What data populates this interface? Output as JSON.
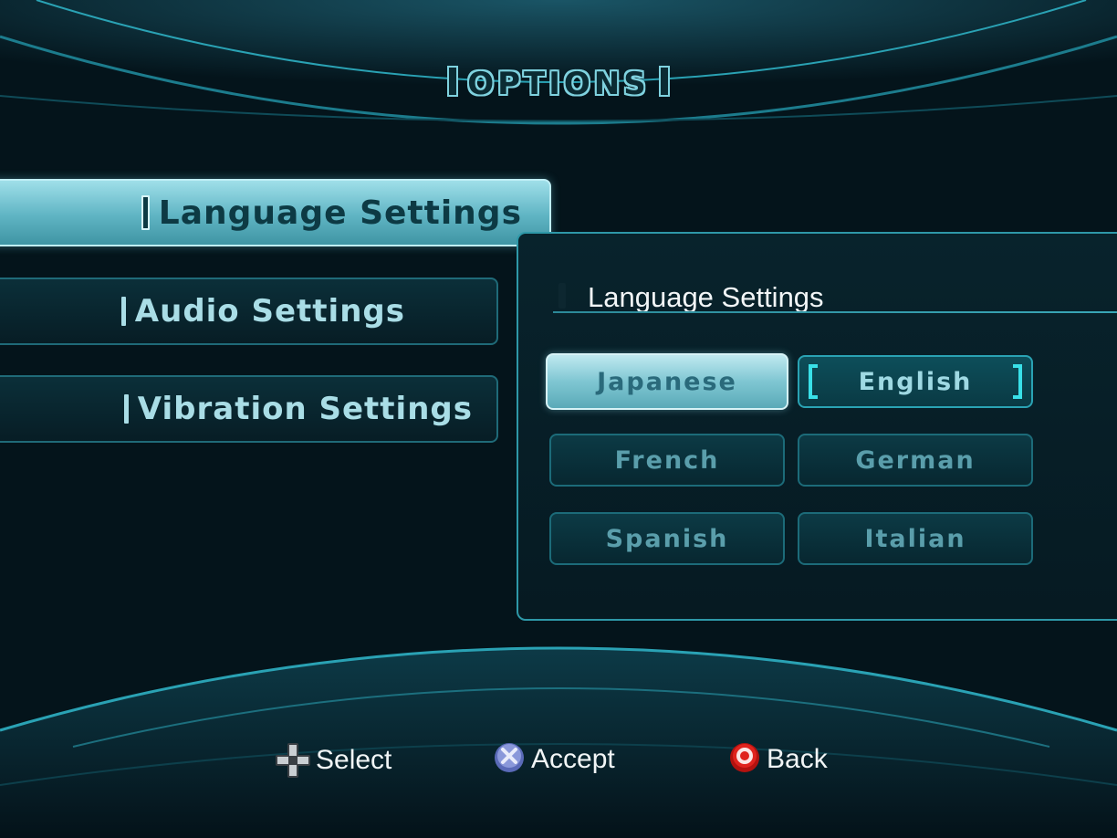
{
  "screen": {
    "title": "OPTIONS"
  },
  "menu": {
    "items": [
      {
        "label": "Language Settings",
        "active": true
      },
      {
        "label": "Audio Settings",
        "active": false
      },
      {
        "label": "Vibration Settings",
        "active": false
      }
    ]
  },
  "language_panel": {
    "title": "Language Settings",
    "focused": "Japanese",
    "selected": "English",
    "options": [
      "Japanese",
      "English",
      "French",
      "German",
      "Spanish",
      "Italian"
    ]
  },
  "hints": {
    "select": {
      "label": "Select",
      "icon": "dpad-icon"
    },
    "accept": {
      "label": "Accept",
      "icon": "cross-button-icon"
    },
    "back": {
      "label": "Back",
      "icon": "circle-button-icon"
    }
  },
  "colors": {
    "accent": "#2e98a8",
    "highlight": "#9fdfe9",
    "selected_bracket": "#39e0e8",
    "back_button": "#e0231e"
  }
}
